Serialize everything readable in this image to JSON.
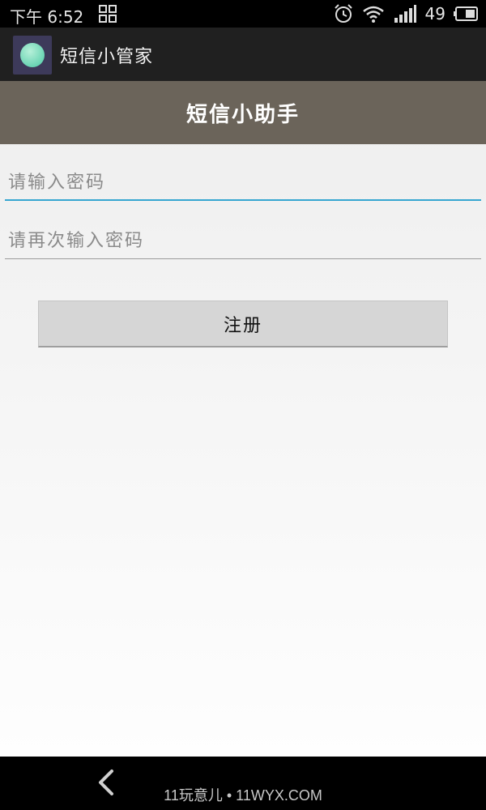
{
  "status_bar": {
    "time": "下午 6:52",
    "battery_level": "49",
    "icons": [
      "grid-icon",
      "alarm-icon",
      "wifi-icon",
      "signal-icon",
      "battery-icon"
    ]
  },
  "app_bar": {
    "title": "短信小管家",
    "icon": "chat-bubble-icon"
  },
  "header": {
    "title": "短信小助手"
  },
  "form": {
    "password_placeholder": "请输入密码",
    "password_value": "",
    "confirm_placeholder": "请再次输入密码",
    "confirm_value": "",
    "register_label": "注册"
  },
  "nav_bar": {
    "back_icon": "back-icon",
    "watermark": "11玩意儿 • 11WYX.COM"
  },
  "colors": {
    "header_bg": "#6b645a",
    "focus_underline": "#36a6d1",
    "button_bg": "#d6d6d6"
  }
}
